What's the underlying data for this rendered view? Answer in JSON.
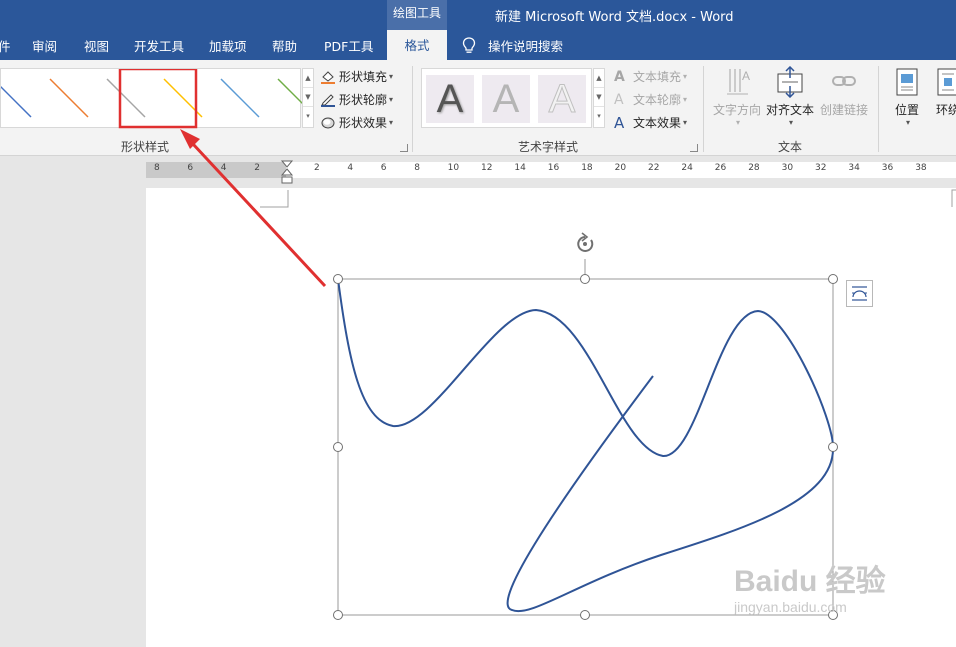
{
  "window": {
    "context_label": "绘图工具",
    "title": "新建 Microsoft Word 文档.docx  -  Word"
  },
  "tabs": [
    {
      "label": "件"
    },
    {
      "label": "审阅"
    },
    {
      "label": "视图"
    },
    {
      "label": "开发工具"
    },
    {
      "label": "加载项"
    },
    {
      "label": "帮助"
    },
    {
      "label": "PDF工具"
    },
    {
      "label": "格式",
      "active": true
    }
  ],
  "search": {
    "label": "操作说明搜索",
    "icon": "lightbulb-icon"
  },
  "ribbon": {
    "shape_styles": {
      "label": "形状样式",
      "gallery_line_colors": [
        "#4472c4",
        "#ed7d31",
        "#a5a5a5",
        "#ffc000",
        "#5b9bd5",
        "#70ad47"
      ],
      "selected_index": 3,
      "fill": "形状填充",
      "outline": "形状轮廓",
      "effects": "形状效果"
    },
    "wordart_styles": {
      "label": "艺术字样式",
      "tiles": [
        "A",
        "A",
        "A"
      ],
      "text_fill": "文本填充",
      "text_outline": "文本轮廓",
      "text_effects": "文本效果"
    },
    "text": {
      "label": "文本",
      "direction": "文字方向",
      "align": "对齐文本",
      "link": "创建链接"
    },
    "arrange": {
      "position": "位置",
      "wrap": "环绕"
    }
  },
  "ruler": {
    "labels": [
      "8",
      "6",
      "4",
      "2",
      "2",
      "4",
      "6",
      "8",
      "10",
      "12",
      "14",
      "16",
      "18",
      "20",
      "22",
      "24",
      "26",
      "28",
      "30",
      "32",
      "34",
      "36",
      "38"
    ]
  },
  "colors": {
    "title_bar": "#2b579a",
    "shape_line": "#2f5496",
    "highlight": "#e03030"
  },
  "watermark": {
    "line1": "Baidu 经验",
    "line2": "jingyan.baidu.com"
  }
}
